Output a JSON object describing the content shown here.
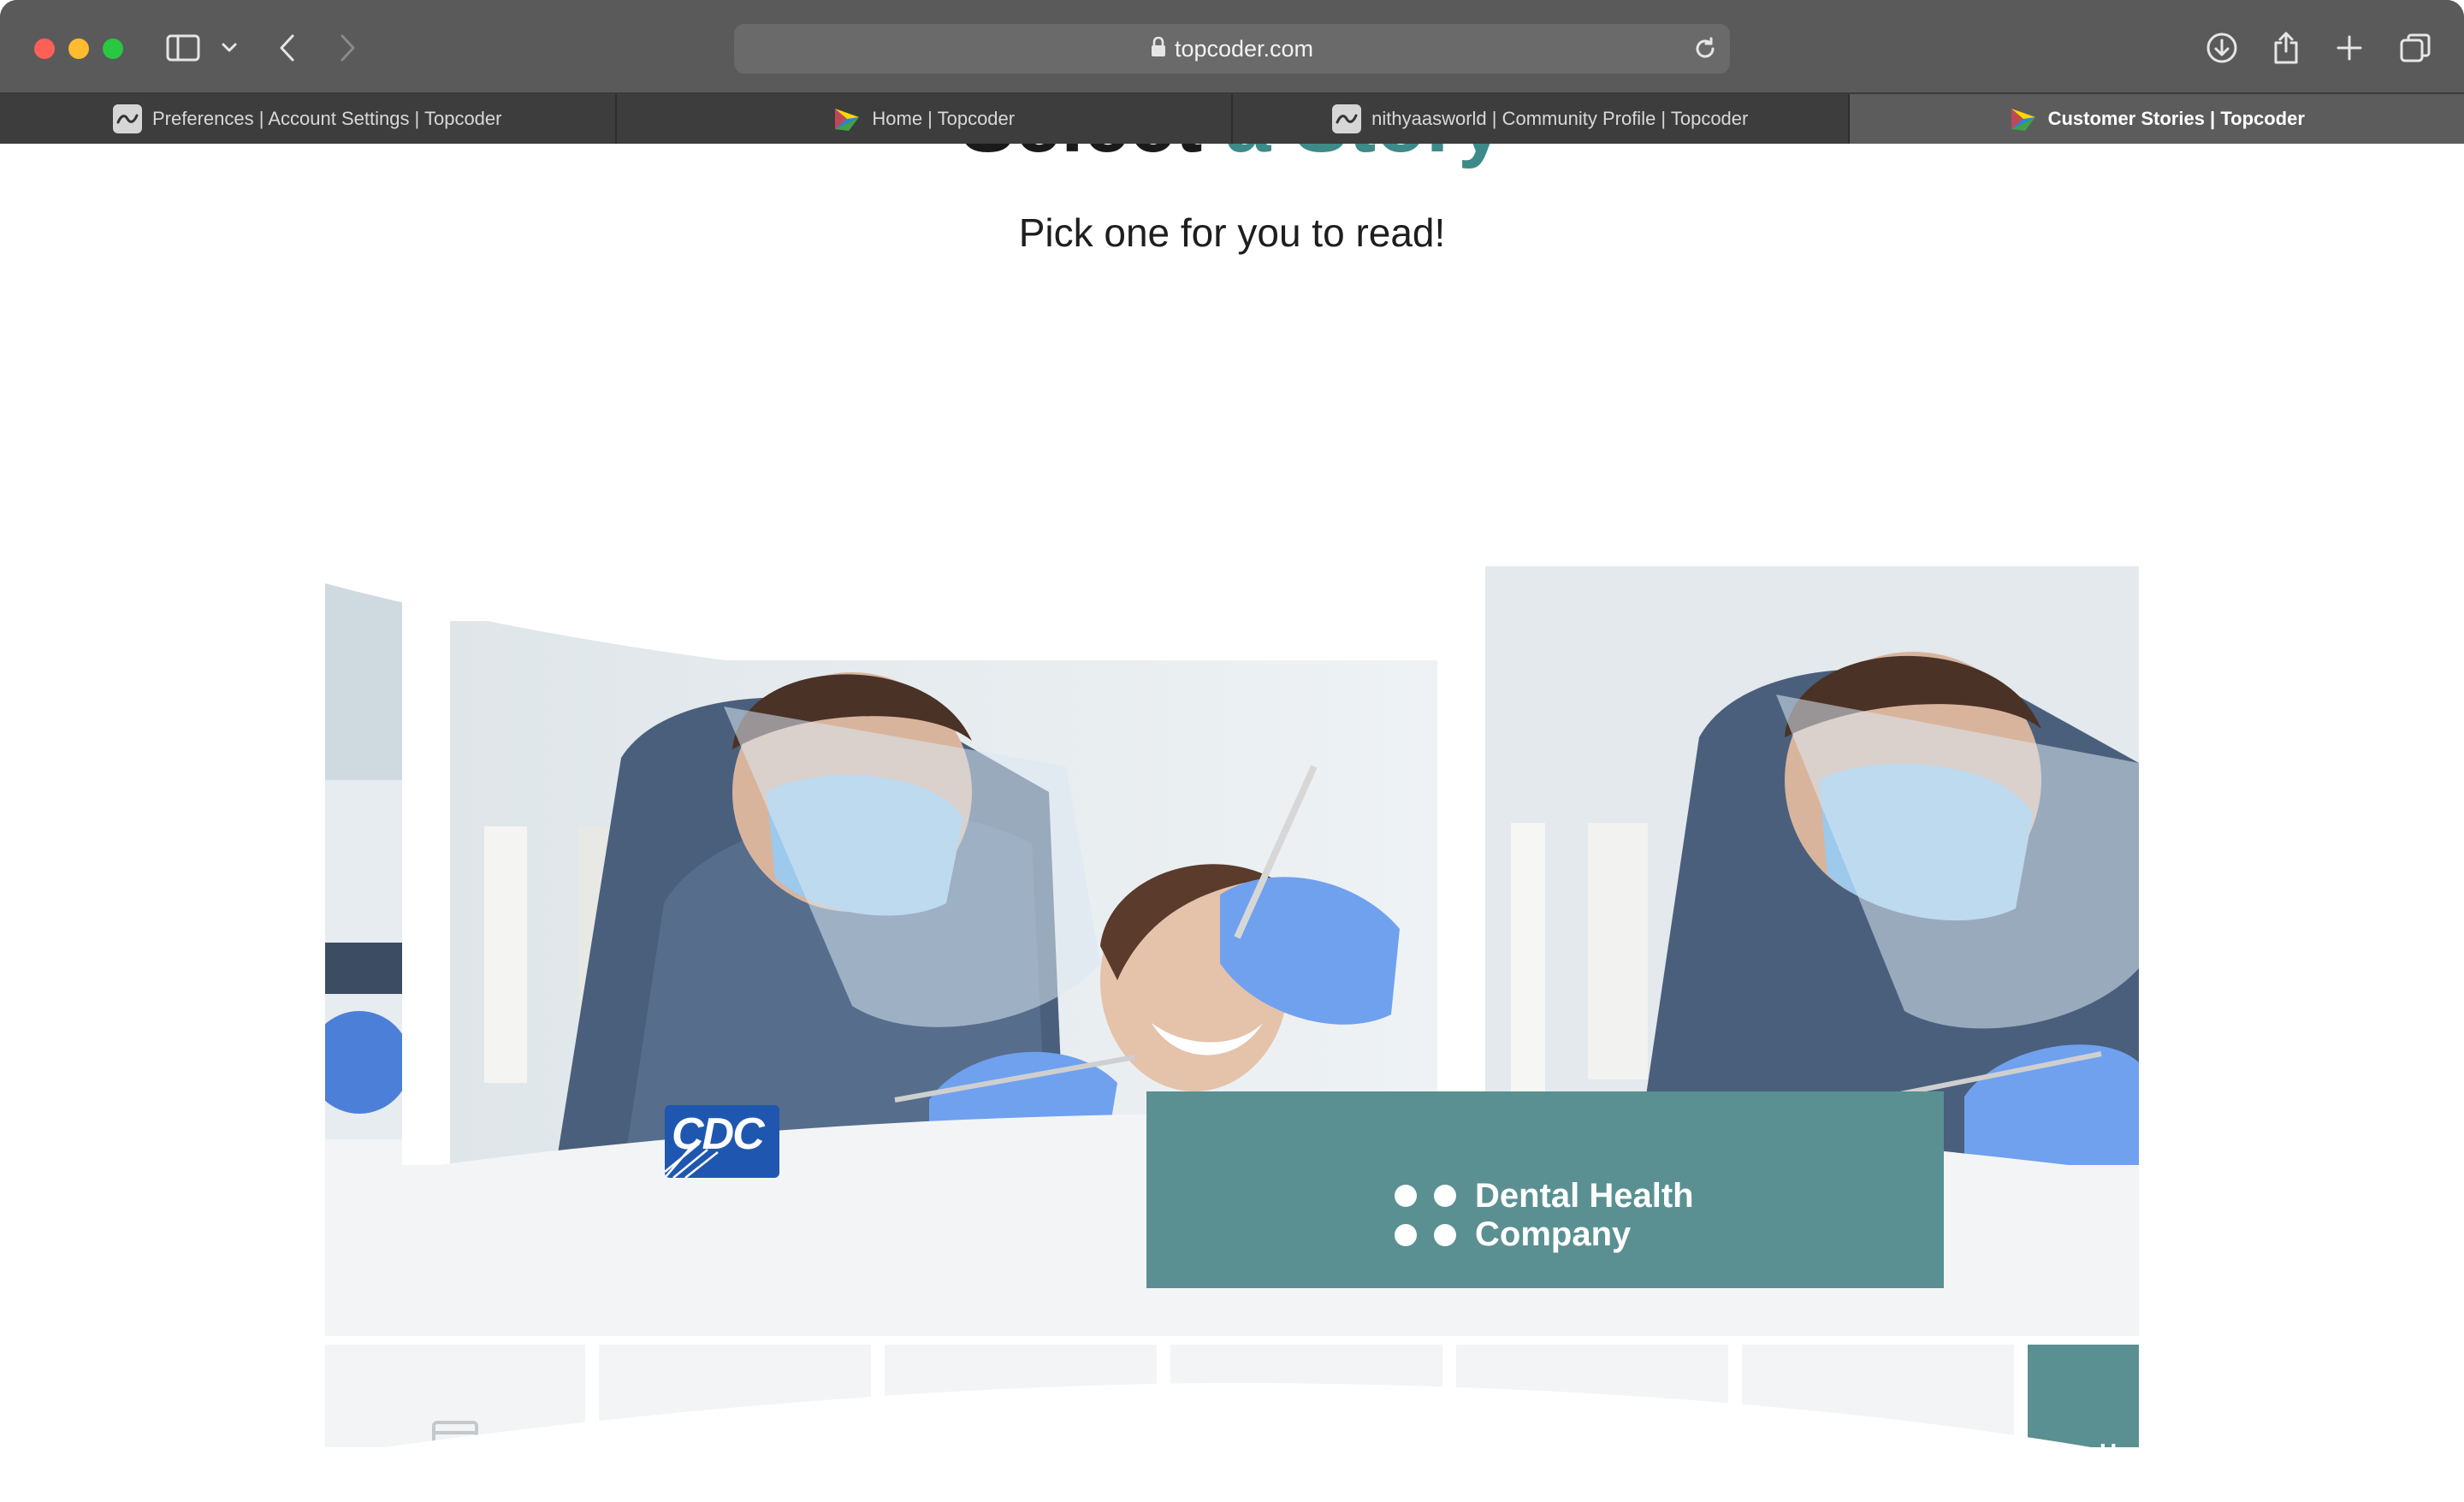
{
  "browser": {
    "url": "topcoder.com",
    "tabs": [
      {
        "title": "Preferences | Account Settings | Topcoder",
        "icon": "user-avatar-icon",
        "active": false
      },
      {
        "title": "Home | Topcoder",
        "icon": "topcoder-logo-icon",
        "active": false
      },
      {
        "title": "nithyaasworld | Community Profile | Topcoder",
        "icon": "user-avatar-icon",
        "active": false
      },
      {
        "title": "Customer Stories | Topcoder",
        "icon": "topcoder-logo-icon",
        "active": true
      }
    ]
  },
  "page": {
    "heading_dark": "Select",
    "heading_accent": "a Story",
    "subtitle": "Pick one for you to read!"
  },
  "stories": {
    "left_logo": "CDC",
    "featured_company": {
      "line1": "Dental Health",
      "line2": "Company"
    },
    "industries": [
      {
        "icon": "credit-card-icon"
      },
      {
        "icon": "satellite-icon"
      },
      {
        "icon": "shopping-cart-icon"
      },
      {
        "icon": "factory-icon"
      },
      {
        "icon": "robot-icon"
      },
      {
        "icon": "laptop-icon"
      },
      {
        "icon": "",
        "label": "Hea"
      }
    ]
  },
  "colors": {
    "accent_teal": "#5a9092",
    "heading_teal": "#3d8b89",
    "cdc_blue": "#1f57b0",
    "chrome_dark": "#3d3d3d"
  }
}
